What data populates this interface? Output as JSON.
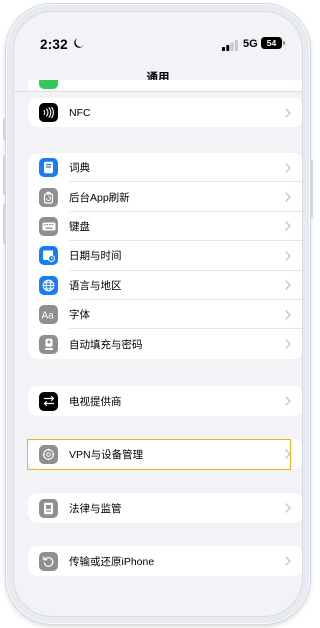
{
  "status_bar": {
    "time": "2:32",
    "network": "5G",
    "battery": "54"
  },
  "nav": {
    "title": "通用"
  },
  "groups": [
    {
      "items": [
        {
          "label": "NFC",
          "icon": "nfc-icon",
          "color": "#000000"
        }
      ]
    },
    {
      "items": [
        {
          "label": "词典",
          "icon": "dictionary-icon",
          "color": "#1a7cf5"
        },
        {
          "label": "后台App刷新",
          "icon": "background-refresh-icon",
          "color": "#8e8e93"
        },
        {
          "label": "键盘",
          "icon": "keyboard-icon",
          "color": "#8e8e93"
        },
        {
          "label": "日期与时间",
          "icon": "date-time-icon",
          "color": "#1a7cf5"
        },
        {
          "label": "语言与地区",
          "icon": "globe-icon",
          "color": "#1a7cf5"
        },
        {
          "label": "字体",
          "icon": "fonts-icon",
          "color": "#8e8e93"
        },
        {
          "label": "自动填充与密码",
          "icon": "autofill-password-icon",
          "color": "#8e8e93"
        }
      ]
    },
    {
      "items": [
        {
          "label": "电视提供商",
          "icon": "tv-provider-icon",
          "color": "#000000"
        }
      ]
    },
    {
      "items": [
        {
          "label": "VPN与设备管理",
          "icon": "vpn-gear-icon",
          "color": "#8e8e93"
        }
      ]
    },
    {
      "items": [
        {
          "label": "法律与监管",
          "icon": "legal-icon",
          "color": "#8e8e93"
        }
      ]
    },
    {
      "items": [
        {
          "label": "传输或还原iPhone",
          "icon": "transfer-reset-icon",
          "color": "#8e8e93"
        }
      ]
    }
  ],
  "highlight_color": "#f0b323"
}
